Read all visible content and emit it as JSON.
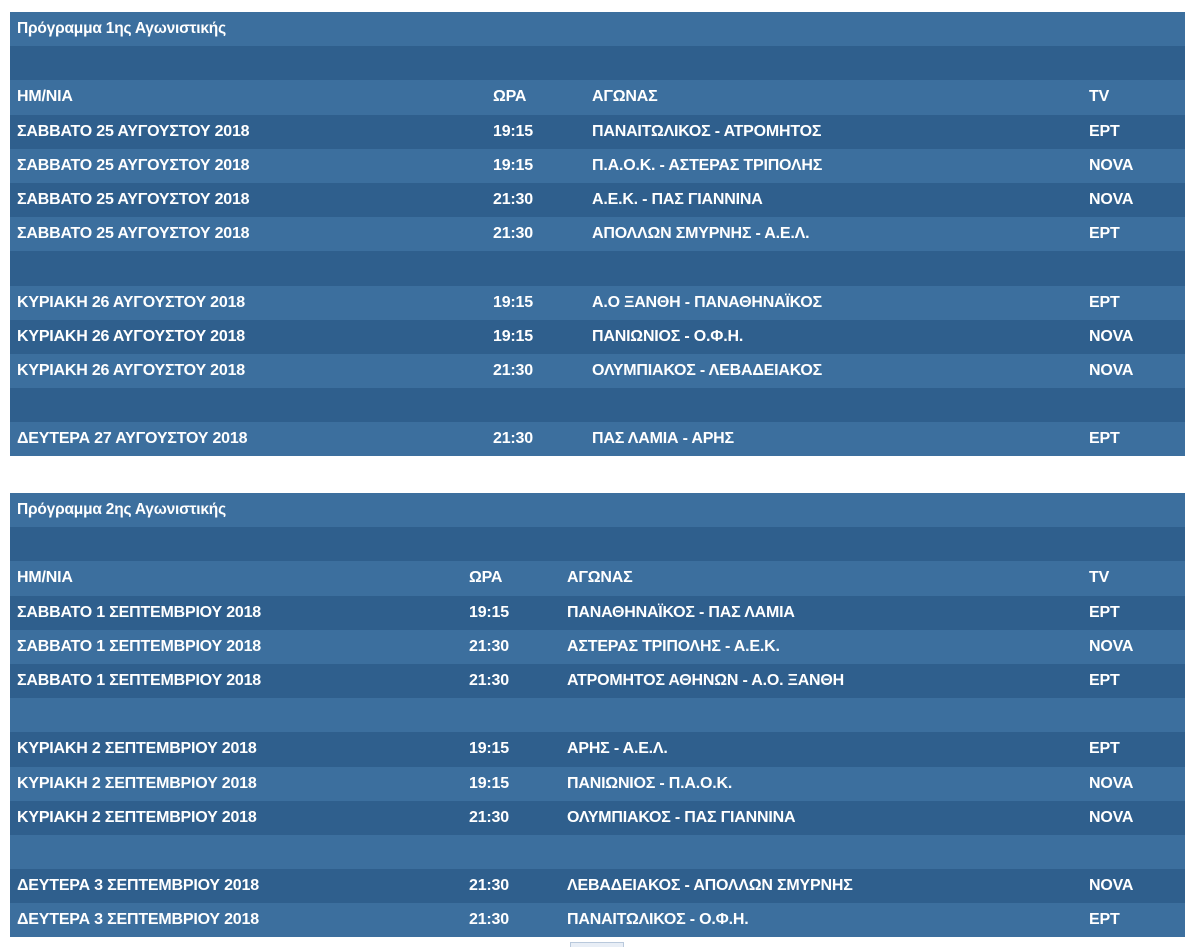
{
  "tables": [
    {
      "title": "Πρόγραμμα 1ης Αγωνιστικής",
      "headers": [
        "ΗΜ/ΝΙΑ",
        "ΩΡΑ",
        "ΑΓΩΝΑΣ",
        "TV"
      ],
      "days": [
        [
          [
            "ΣΑΒΒΑΤΟ 25 ΑΥΓΟΥΣΤΟΥ 2018",
            "19:15",
            "ΠΑΝΑΙΤΩΛΙΚΟΣ - ΑΤΡΟΜΗΤΟΣ",
            "ΕΡΤ"
          ],
          [
            "ΣΑΒΒΑΤΟ 25 ΑΥΓΟΥΣΤΟΥ 2018",
            "19:15",
            "Π.Α.Ο.Κ. - ΑΣΤΕΡΑΣ ΤΡΙΠΟΛΗΣ",
            "NOVA"
          ],
          [
            "ΣΑΒΒΑΤΟ 25 ΑΥΓΟΥΣΤΟΥ 2018",
            "21:30",
            "Α.Ε.Κ. - ΠΑΣ ΓΙΑΝΝΙΝΑ",
            "NOVA"
          ],
          [
            "ΣΑΒΒΑΤΟ 25 ΑΥΓΟΥΣΤΟΥ 2018",
            "21:30",
            "ΑΠΟΛΛΩΝ ΣΜΥΡΝΗΣ - Α.Ε.Λ.",
            "ΕΡΤ"
          ]
        ],
        [
          [
            "ΚΥΡΙΑΚΗ 26 ΑΥΓΟΥΣΤΟΥ 2018",
            "19:15",
            "Α.Ο ΞΑΝΘΗ - ΠΑΝΑΘΗΝΑΪΚΟΣ",
            "ΕΡΤ"
          ],
          [
            "ΚΥΡΙΑΚΗ 26 ΑΥΓΟΥΣΤΟΥ 2018",
            "19:15",
            "ΠΑΝΙΩΝΙΟΣ - Ο.Φ.Η.",
            "NOVA"
          ],
          [
            "ΚΥΡΙΑΚΗ 26 ΑΥΓΟΥΣΤΟΥ 2018",
            "21:30",
            "ΟΛΥΜΠΙΑΚΟΣ - ΛΕΒΑΔΕΙΑΚΟΣ",
            "NOVA"
          ]
        ],
        [
          [
            "ΔΕΥΤΕΡΑ 27 ΑΥΓΟΥΣΤΟΥ 2018",
            "21:30",
            "ΠΑΣ ΛΑΜΙΑ - ΑΡΗΣ",
            "ΕΡΤ"
          ]
        ]
      ]
    },
    {
      "title": "Πρόγραμμα 2ης Αγωνιστικής",
      "headers": [
        "ΗΜ/ΝΙΑ",
        "ΩΡΑ",
        "ΑΓΩΝΑΣ",
        "TV"
      ],
      "days": [
        [
          [
            "ΣΑΒΒΑΤΟ 1 ΣΕΠΤΕΜΒΡΙΟΥ 2018",
            "19:15",
            "ΠΑΝΑΘΗΝΑΪΚΟΣ - ΠΑΣ ΛΑΜΙΑ",
            "ΕΡΤ"
          ],
          [
            "ΣΑΒΒΑΤΟ 1 ΣΕΠΤΕΜΒΡΙΟΥ 2018",
            "21:30",
            "ΑΣΤΕΡΑΣ ΤΡΙΠΟΛΗΣ - Α.Ε.Κ.",
            "NOVA"
          ],
          [
            "ΣΑΒΒΑΤΟ 1 ΣΕΠΤΕΜΒΡΙΟΥ 2018",
            "21:30",
            "ΑΤΡΟΜΗΤΟΣ ΑΘΗΝΩΝ - Α.Ο. ΞΑΝΘΗ",
            "ΕΡΤ"
          ]
        ],
        [
          [
            "ΚΥΡΙΑΚΗ 2 ΣΕΠΤΕΜΒΡΙΟΥ 2018",
            "19:15",
            "ΑΡΗΣ - Α.Ε.Λ.",
            "ΕΡΤ"
          ],
          [
            "ΚΥΡΙΑΚΗ 2 ΣΕΠΤΕΜΒΡΙΟΥ 2018",
            "19:15",
            "ΠΑΝΙΩΝΙΟΣ - Π.Α.Ο.Κ.",
            "NOVA"
          ],
          [
            "ΚΥΡΙΑΚΗ 2 ΣΕΠΤΕΜΒΡΙΟΥ 2018",
            "21:30",
            "ΟΛΥΜΠΙΑΚΟΣ - ΠΑΣ ΓΙΑΝΝΙΝΑ",
            "NOVA"
          ]
        ],
        [
          [
            "ΔΕΥΤΕΡΑ 3 ΣΕΠΤΕΜΒΡΙΟΥ 2018",
            "21:30",
            "ΛΕΒΑΔΕΙΑΚΟΣ - ΑΠΟΛΛΩΝ ΣΜΥΡΝΗΣ",
            "NOVA"
          ],
          [
            "ΔΕΥΤΕΡΑ 3 ΣΕΠΤΕΜΒΡΙΟΥ 2018",
            "21:30",
            "ΠΑΝΑΙΤΩΛΙΚΟΣ - Ο.Φ.Η.",
            "ΕΡΤ"
          ]
        ]
      ]
    }
  ]
}
